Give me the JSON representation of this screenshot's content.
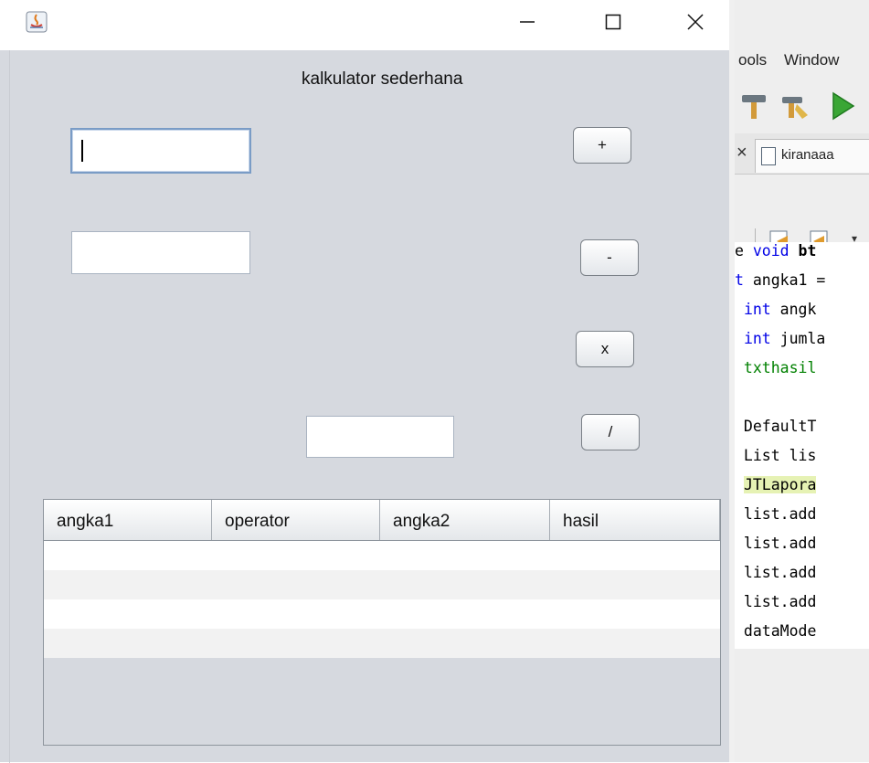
{
  "calculator": {
    "heading": "kalkulator sederhana",
    "input1_value": "",
    "input2_value": "",
    "result_value": "",
    "buttons": {
      "add": "+",
      "subtract": "-",
      "multiply": "x",
      "divide": "/"
    },
    "table": {
      "columns": [
        "angka1",
        "operator",
        "angka2",
        "hasil"
      ],
      "rows": [
        [
          "",
          "",
          "",
          ""
        ],
        [
          "",
          "",
          "",
          ""
        ],
        [
          "",
          "",
          "",
          ""
        ],
        [
          "",
          "",
          "",
          ""
        ]
      ]
    }
  },
  "window_controls": {
    "minimize": "—",
    "maximize": "☐",
    "close": "✕"
  },
  "ide": {
    "menu": [
      "ools",
      "Window"
    ],
    "tab_label": "kiranaaa",
    "code_lines": [
      {
        "pre": "e ",
        "kw": "void",
        "post": " bt"
      },
      {
        "pre": "t angka1 =",
        "kw": "",
        "post": ""
      },
      {
        "pre": " ",
        "kw": "int",
        "post": " angk"
      },
      {
        "pre": " ",
        "kw": "int",
        "post": " jumla"
      },
      {
        "pre": " txthasil",
        "kw": "",
        "post": ""
      },
      {
        "pre": "",
        "kw": "",
        "post": ""
      },
      {
        "pre": " DefaultT",
        "kw": "",
        "post": ""
      },
      {
        "pre": " List lis",
        "kw": "",
        "post": ""
      },
      {
        "pre": " JTLapora",
        "kw": "",
        "post": ""
      },
      {
        "pre": " list.add",
        "kw": "",
        "post": ""
      },
      {
        "pre": " list.add",
        "kw": "",
        "post": ""
      },
      {
        "pre": " list.add",
        "kw": "",
        "post": ""
      },
      {
        "pre": " list.add",
        "kw": "",
        "post": ""
      },
      {
        "pre": " dataMode",
        "kw": "",
        "post": ""
      }
    ]
  },
  "colors": {
    "window_bg": "#d6d9df",
    "keyword": "#0000e6",
    "string_green": "#008000",
    "highlight": "#e6f2b4"
  }
}
